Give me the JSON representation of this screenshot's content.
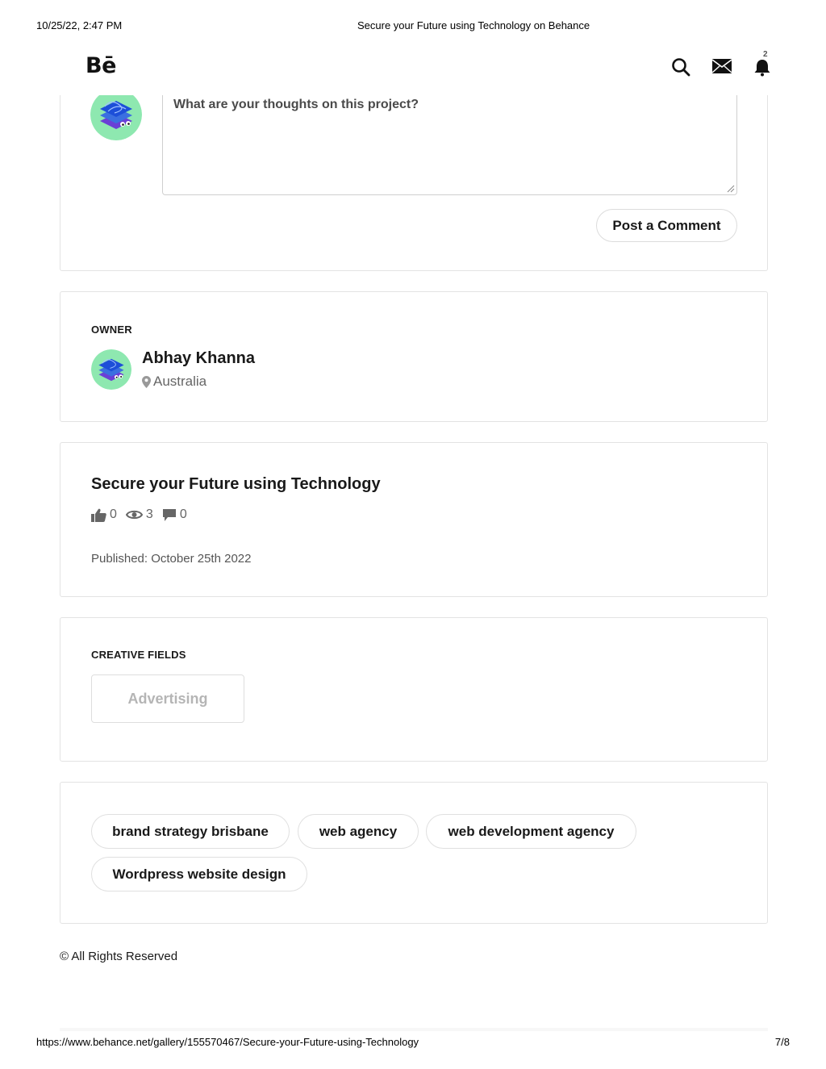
{
  "print_header": {
    "datetime": "10/25/22, 2:47 PM",
    "title": "Secure your Future using Technology on Behance"
  },
  "print_footer": {
    "url": "https://www.behance.net/gallery/155570467/Secure-your-Future-using-Technology",
    "page": "7/8"
  },
  "nav": {
    "logo": "Bē",
    "icons": [
      "search-icon",
      "mail-icon",
      "bell-icon"
    ],
    "notification_count": "2"
  },
  "comment": {
    "placeholder": "What are your thoughts on this project?",
    "post_label": "Post a Comment"
  },
  "owner": {
    "label": "OWNER",
    "name": "Abhay Khanna",
    "location": "Australia"
  },
  "project": {
    "title": "Secure your Future using Technology",
    "appreciations": "0",
    "views": "3",
    "comments": "0",
    "published": "Published: October 25th 2022"
  },
  "creative_fields": {
    "label": "CREATIVE FIELDS",
    "items": [
      "Advertising"
    ]
  },
  "tags": [
    "brand strategy brisbane",
    "web agency",
    "web development agency",
    "Wordpress website design"
  ],
  "footer": {
    "copyright": "© All Rights Reserved"
  },
  "colors": {
    "text": "#191919",
    "muted": "#666666",
    "border": "#e3e3e3",
    "avatar_bg": "#8ee8b0",
    "avatar_blue": "#1d4fd8",
    "avatar_purple": "#6a3fd6"
  }
}
